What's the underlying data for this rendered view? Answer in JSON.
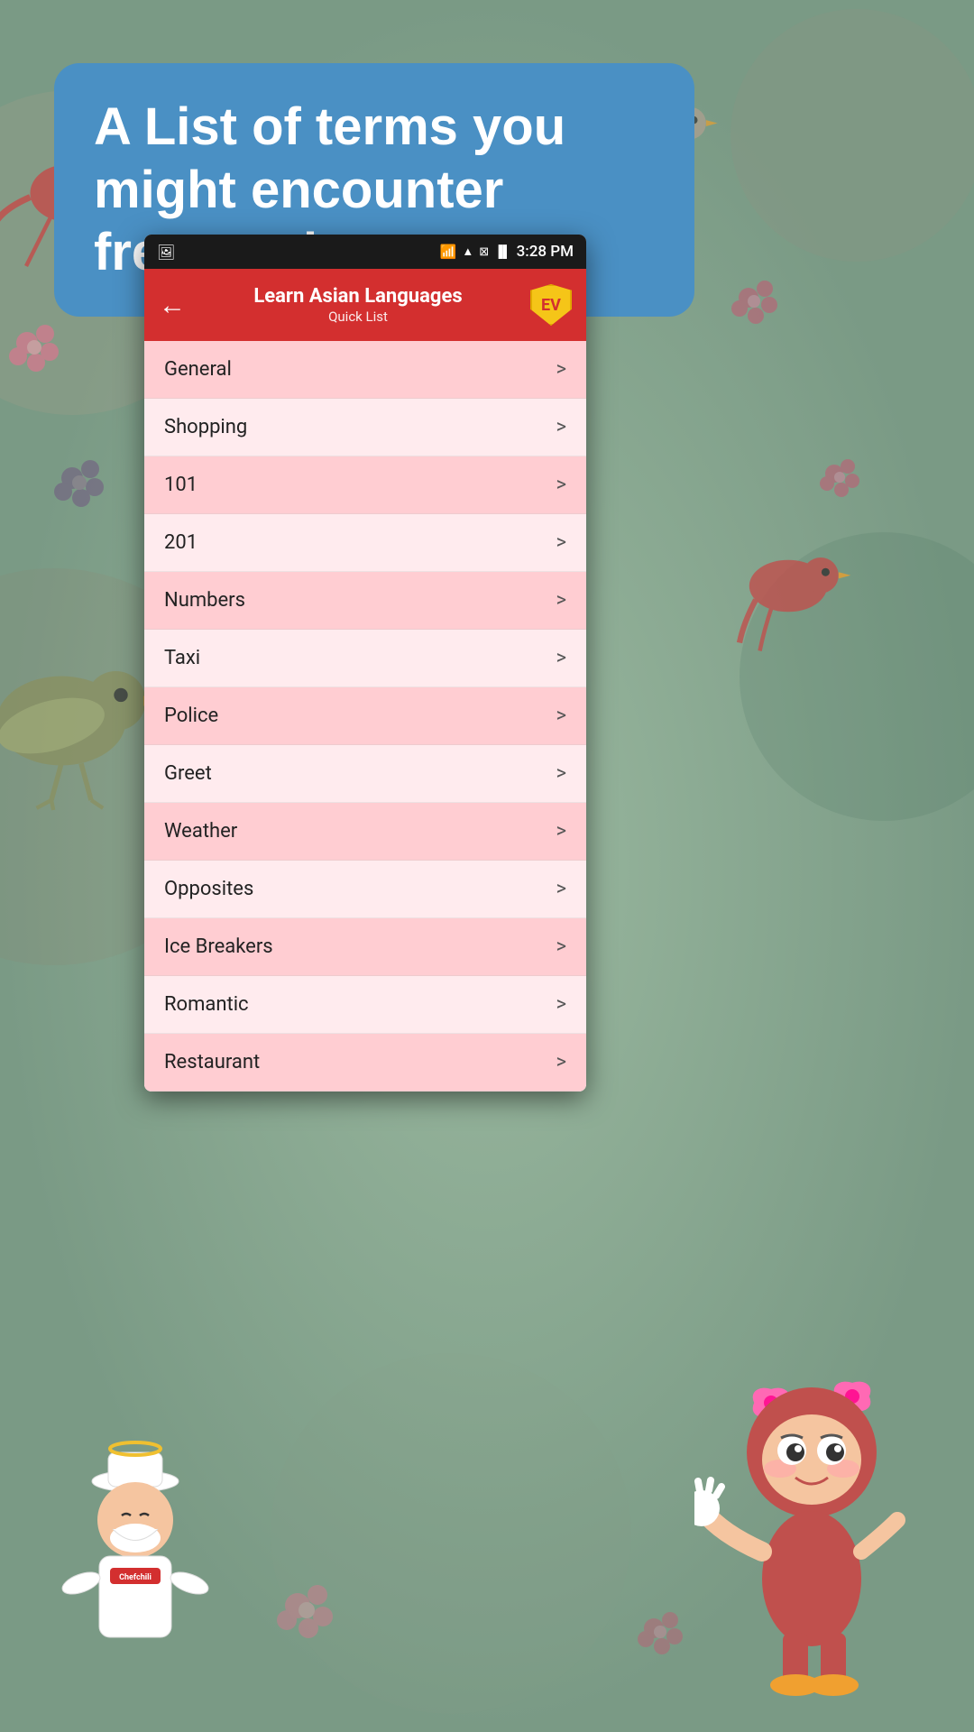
{
  "background": {
    "color": "#8aab96"
  },
  "header_banner": {
    "text": "A List of terms you might encounter frequently",
    "bg_color": "#4a90c4"
  },
  "status_bar": {
    "time": "3:28 PM",
    "wifi_icon": "wifi",
    "battery_icon": "battery",
    "photo_icon": "photo"
  },
  "app_header": {
    "title": "Learn Asian Languages",
    "subtitle": "Quick List",
    "back_label": "←",
    "bg_color": "#d32f2f",
    "logo_text": "EV"
  },
  "list_items": [
    {
      "label": "General",
      "arrow": ">"
    },
    {
      "label": "Shopping",
      "arrow": ">"
    },
    {
      "label": "101",
      "arrow": ">"
    },
    {
      "label": "201",
      "arrow": ">"
    },
    {
      "label": "Numbers",
      "arrow": ">"
    },
    {
      "label": "Taxi",
      "arrow": ">"
    },
    {
      "label": "Police",
      "arrow": ">"
    },
    {
      "label": "Greet",
      "arrow": ">"
    },
    {
      "label": "Weather",
      "arrow": ">"
    },
    {
      "label": "Opposites",
      "arrow": ">"
    },
    {
      "label": "Ice Breakers",
      "arrow": ">"
    },
    {
      "label": "Romantic",
      "arrow": ">"
    },
    {
      "label": "Restaurant",
      "arrow": ">"
    }
  ],
  "characters": {
    "chef_name": "Chefchili",
    "girl_name": "mascot-girl"
  }
}
